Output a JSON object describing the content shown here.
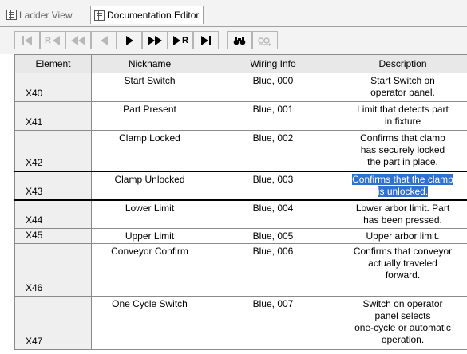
{
  "tabs": [
    {
      "label": "Ladder View",
      "active": false
    },
    {
      "label": "Documentation Editor",
      "active": true
    }
  ],
  "toolbar": {
    "buttons": [
      {
        "name": "first",
        "icon": "skip-to-start-icon",
        "enabled": false
      },
      {
        "name": "prev-rung",
        "label": "R",
        "icon": "rung-prev-icon",
        "enabled": false
      },
      {
        "name": "fast-back",
        "icon": "fast-rewind-icon",
        "enabled": false
      },
      {
        "name": "back",
        "icon": "step-back-icon",
        "enabled": false
      },
      {
        "name": "forward",
        "icon": "play-icon",
        "enabled": true
      },
      {
        "name": "fast-forward",
        "icon": "fast-forward-icon",
        "enabled": true
      },
      {
        "name": "next-rung",
        "label": "R",
        "icon": "rung-next-icon",
        "enabled": true
      },
      {
        "name": "last",
        "icon": "skip-to-end-icon",
        "enabled": true
      },
      {
        "name": "find",
        "icon": "binoculars-icon",
        "enabled": true
      },
      {
        "name": "find-next",
        "icon": "binoculars-next-icon",
        "enabled": false
      }
    ]
  },
  "grid": {
    "headers": {
      "element": "Element",
      "nickname": "Nickname",
      "wiring": "Wiring Info",
      "description": "Description"
    },
    "rows": [
      {
        "element": "X40",
        "nickname": "Start Switch",
        "wiring": "Blue, 000",
        "description": [
          "Start Switch on",
          "operator panel."
        ]
      },
      {
        "element": "X41",
        "nickname": "Part Present",
        "wiring": "Blue, 001",
        "description": [
          "Limit that detects part",
          "in fixture"
        ]
      },
      {
        "element": "X42",
        "nickname": "Clamp Locked",
        "wiring": "Blue, 002",
        "description": [
          "Confirms that clamp",
          "has securely locked",
          "the part in place."
        ]
      },
      {
        "element": "X43",
        "nickname": "Clamp Unlocked",
        "wiring": "Blue, 003",
        "description": [
          "Confirms that the clamp",
          "is unlocked."
        ],
        "selected": true
      },
      {
        "element": "X44",
        "nickname": "Lower Limit",
        "wiring": "Blue, 004",
        "description": [
          "Lower arbor limit. Part",
          "has been pressed."
        ]
      },
      {
        "element": "X45",
        "nickname": "Upper Limit",
        "wiring": "Blue, 005",
        "description": [
          "Upper arbor limit."
        ]
      },
      {
        "element": "X46",
        "nickname": "Conveyor Confirm",
        "wiring": "Blue, 006",
        "description": [
          "Confirms that conveyor",
          "actually traveled",
          "forward."
        ]
      },
      {
        "element": "X47",
        "nickname": "One Cycle Switch",
        "wiring": "Blue, 007",
        "description": [
          "Switch on operator",
          "panel selects",
          "one-cycle or automatic",
          "operation."
        ]
      }
    ]
  }
}
